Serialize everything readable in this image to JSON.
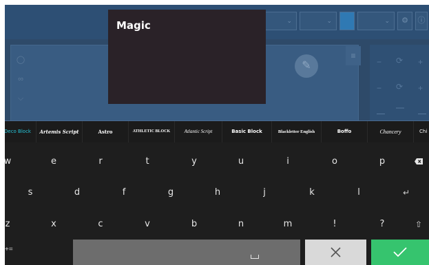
{
  "preview": {
    "text": "Magic"
  },
  "fonts": [
    {
      "label": "Deco Block",
      "active": true
    },
    {
      "label": "Artemis Script",
      "active": false
    },
    {
      "label": "Astro",
      "active": false
    },
    {
      "label": "ATHLETIC BLOCK",
      "active": false
    },
    {
      "label": "Atlantic Script",
      "active": false
    },
    {
      "label": "Basic Block",
      "active": false
    },
    {
      "label": "Blackletter English",
      "active": false
    },
    {
      "label": "Boffo",
      "active": false
    },
    {
      "label": "Chancery",
      "active": false
    },
    {
      "label": "Chi",
      "active": false
    }
  ],
  "keyboard": {
    "row1": [
      "w",
      "e",
      "r",
      "t",
      "y",
      "u",
      "i",
      "o",
      "p"
    ],
    "row2": [
      "s",
      "d",
      "f",
      "g",
      "h",
      "j",
      "k",
      "l"
    ],
    "row3": [
      "z",
      "x",
      "c",
      "v",
      "b",
      "n",
      "m",
      "!",
      "?"
    ],
    "symbols_label": "+=",
    "icons": {
      "backspace": "backspace-icon",
      "enter": "enter-icon",
      "shift": "shift-icon",
      "space": "space-icon",
      "cancel": "close-icon",
      "confirm": "checkmark-icon"
    }
  },
  "colors": {
    "keyboard_bg": "#1e1e1e",
    "active_font": "#26c6da",
    "confirm": "#36c46e",
    "cancel": "#d9d9d9",
    "space": "#6d6d6d",
    "preview_bg": "#2a2228"
  }
}
